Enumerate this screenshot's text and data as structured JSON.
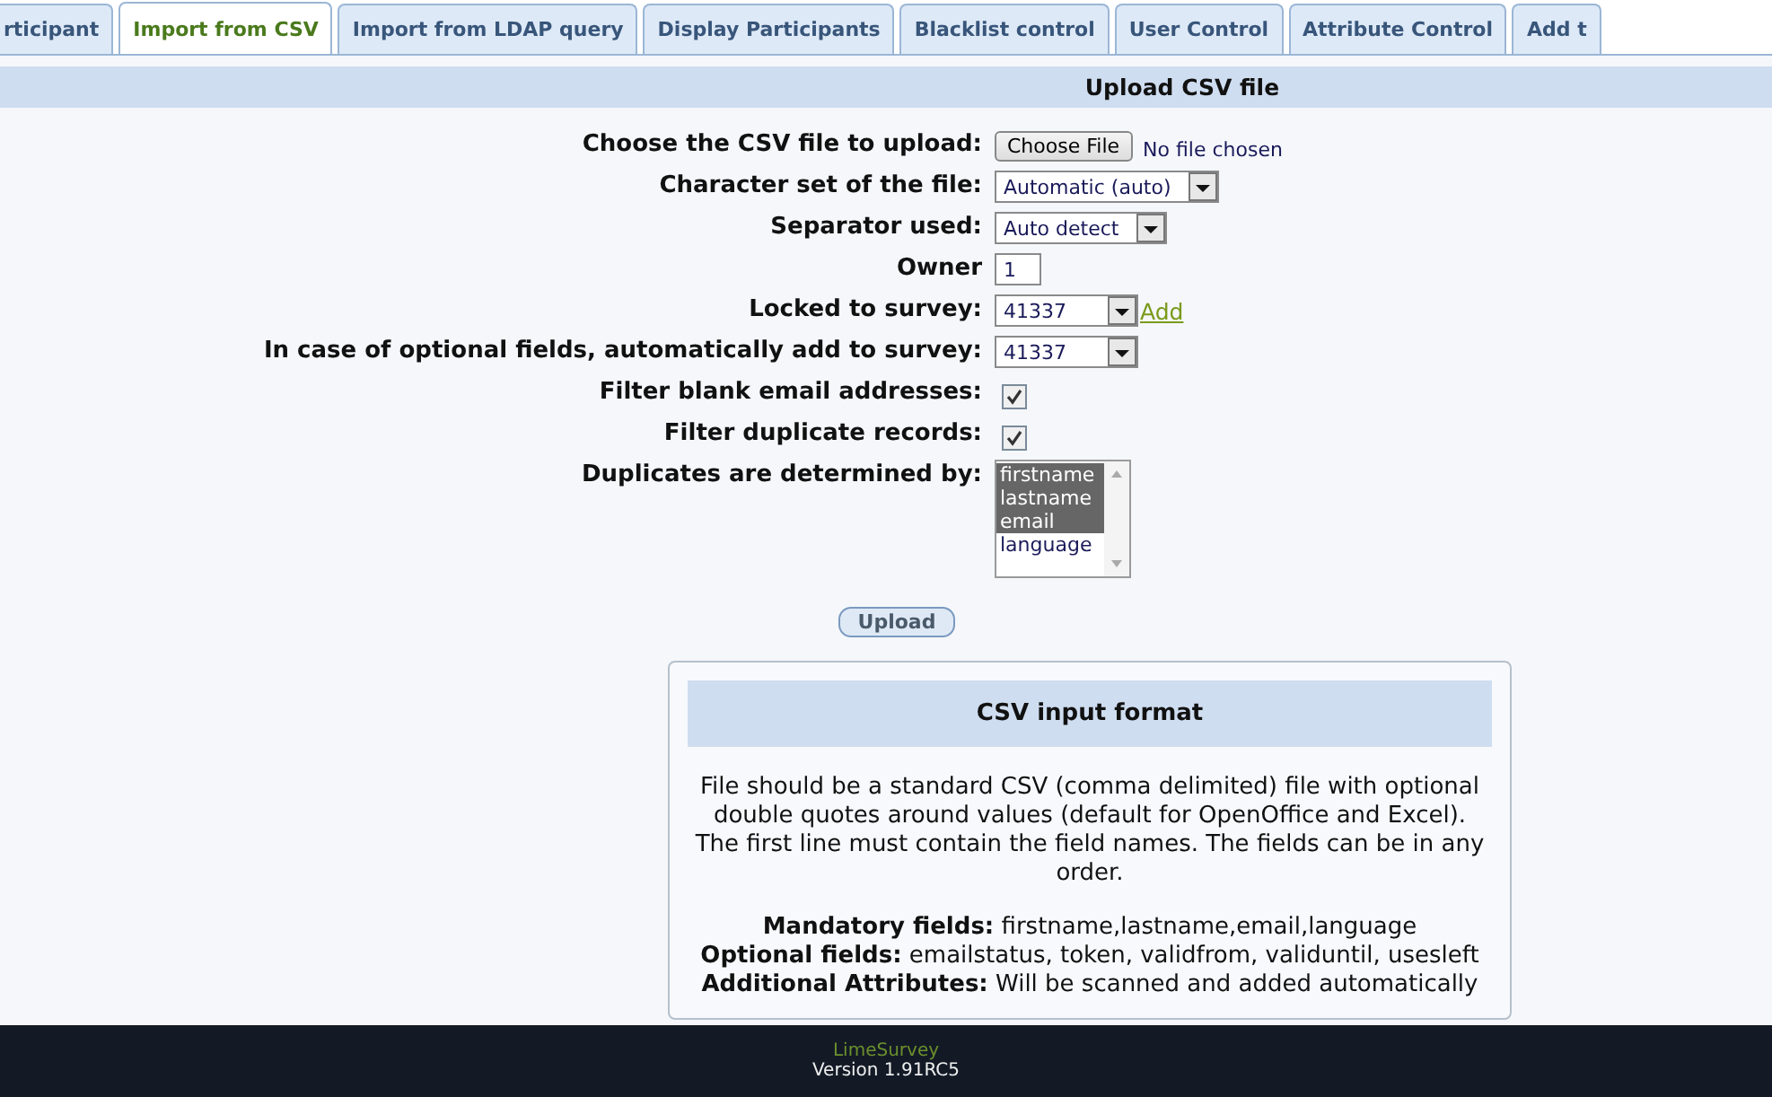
{
  "tabs": [
    {
      "label": "rticipant",
      "selected": false
    },
    {
      "label": "Import from CSV",
      "selected": true
    },
    {
      "label": "Import from LDAP query",
      "selected": false
    },
    {
      "label": "Display Participants",
      "selected": false
    },
    {
      "label": "Blacklist control",
      "selected": false
    },
    {
      "label": "User Control",
      "selected": false
    },
    {
      "label": "Attribute Control",
      "selected": false
    },
    {
      "label": "Add t",
      "selected": false
    }
  ],
  "section_title": "Upload CSV file",
  "form": [
    {
      "kind": "file",
      "label": "Choose the CSV file to upload:",
      "button": "Choose File",
      "value": "No file chosen"
    },
    {
      "kind": "select",
      "label": "Character set of the file:",
      "value": "Automatic (auto)"
    },
    {
      "kind": "select",
      "label": "Separator used:",
      "value": "Auto detect"
    },
    {
      "kind": "text",
      "label": "Owner",
      "value": "1"
    },
    {
      "kind": "select",
      "label": "Locked to survey:",
      "value": "41337",
      "link": "Add"
    },
    {
      "kind": "select",
      "label": "In case of optional fields, automatically add to survey:",
      "value": "41337"
    },
    {
      "kind": "checkbox",
      "label": "Filter blank email addresses:",
      "checked": true
    },
    {
      "kind": "checkbox",
      "label": "Filter duplicate records:",
      "checked": true
    },
    {
      "kind": "listbox",
      "label": "Duplicates are determined by:",
      "options": [
        {
          "label": "firstname",
          "selected": true
        },
        {
          "label": "lastname",
          "selected": true
        },
        {
          "label": "email",
          "selected": true
        },
        {
          "label": "language",
          "selected": false
        }
      ]
    }
  ],
  "upload_button": "Upload",
  "info": {
    "title": "CSV input format",
    "description": "File should be a standard CSV (comma delimited) file with optional double quotes around values (default for OpenOffice and Excel). The first line must contain the field names. The fields can be in any order.",
    "lines": [
      "**Mandatory fields:** firstname,lastname,email,language",
      "**Optional fields:** emailstatus, token, validfrom, validuntil, usesleft",
      "**Additional Attributes:** Will be scanned and added automatically"
    ]
  },
  "footer": {
    "brand": "LimeSurvey",
    "version": "Version 1.91RC5"
  }
}
